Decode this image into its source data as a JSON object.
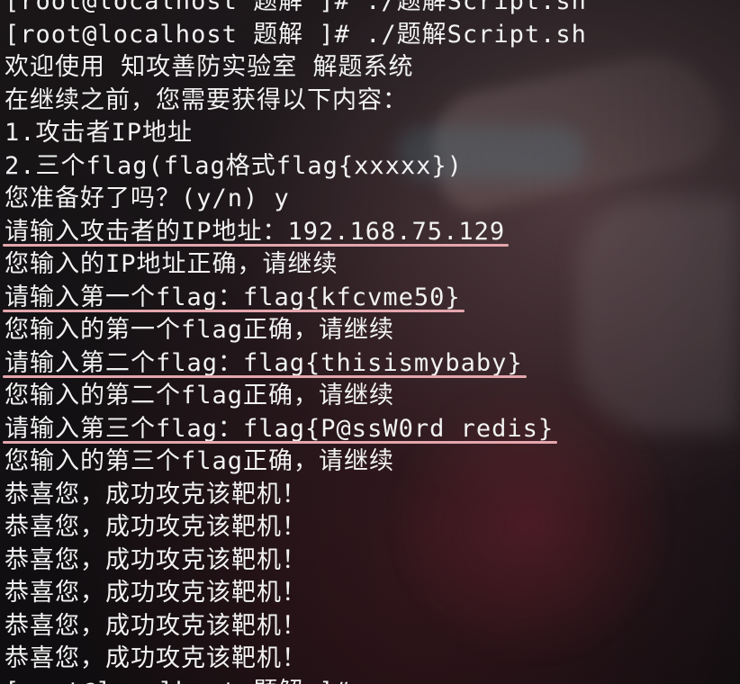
{
  "lines": [
    {
      "text": "[root@localhost 题解 ]# ./题解Script.sh",
      "highlight": false
    },
    {
      "text": "[root@localhost 题解 ]# ./题解Script.sh",
      "highlight": false
    },
    {
      "text": "欢迎使用 知攻善防实验室 解题系统",
      "highlight": false
    },
    {
      "text": "在继续之前，您需要获得以下内容：",
      "highlight": false
    },
    {
      "text": "1.攻击者IP地址",
      "highlight": false
    },
    {
      "text": "2.三个flag(flag格式flag{xxxxx})",
      "highlight": false
    },
    {
      "text": "您准备好了吗？(y/n) y",
      "highlight": false
    },
    {
      "text": "请输入攻击者的IP地址：192.168.75.129",
      "highlight": true
    },
    {
      "text": "您输入的IP地址正确，请继续",
      "highlight": false
    },
    {
      "text": "请输入第一个flag：flag{kfcvme50}",
      "highlight": true
    },
    {
      "text": "您输入的第一个flag正确，请继续",
      "highlight": false
    },
    {
      "text": "请输入第二个flag：flag{thisismybaby}",
      "highlight": true
    },
    {
      "text": "您输入的第二个flag正确，请继续",
      "highlight": false
    },
    {
      "text": "请输入第三个flag：flag{P@ssW0rd_redis}",
      "highlight": true
    },
    {
      "text": "您输入的第三个flag正确，请继续",
      "highlight": false
    },
    {
      "text": "恭喜您，成功攻克该靶机！",
      "highlight": false
    },
    {
      "text": "恭喜您，成功攻克该靶机！",
      "highlight": false
    },
    {
      "text": "恭喜您，成功攻克该靶机！",
      "highlight": false
    },
    {
      "text": "恭喜您，成功攻克该靶机！",
      "highlight": false
    },
    {
      "text": "恭喜您，成功攻克该靶机！",
      "highlight": false
    },
    {
      "text": "恭喜您，成功攻克该靶机！",
      "highlight": false
    },
    {
      "text": "[root@localhost 题解 ]#",
      "highlight": false
    }
  ],
  "colors": {
    "text": "#f2f2f2",
    "underline": "#e4a6ad"
  }
}
